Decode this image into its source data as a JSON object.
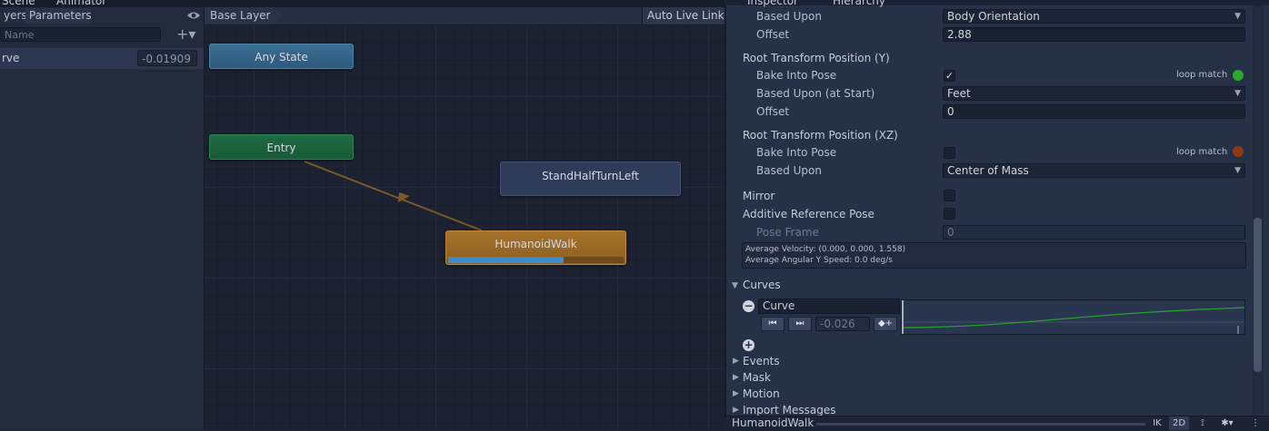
{
  "left_panel": {
    "tabs": [
      "yers",
      "Parameters"
    ],
    "search_placeholder": "Name",
    "add_label": "+▾",
    "parameter": {
      "name": "rve",
      "value": "-0.01909"
    }
  },
  "window_tabs": {
    "scene": "Scene",
    "animator": "Animator",
    "inspector": "Inspector",
    "hierarchy": "Hierarchy"
  },
  "graph": {
    "breadcrumb": "Base Layer",
    "auto_live_link": "Auto Live Link",
    "nodes": {
      "any_state": "Any State",
      "entry": "Entry",
      "stand": "StandHalfTurnLeft",
      "walk": "HumanoidWalk"
    },
    "walk_progress": 0.66,
    "colors": {
      "any": "#3a6d92",
      "entry": "#1f6b42",
      "walk": "#a6722a",
      "progress": "#3b8dd0",
      "transition": "#7a5a26"
    }
  },
  "inspector": {
    "based_upon_label": "Based Upon",
    "based_upon_value": "Body Orientation",
    "offset_label": "Offset",
    "offset_value": "2.88",
    "root_y_header": "Root Transform Position (Y)",
    "bake_label": "Bake Into Pose",
    "bake_y_checked": "✓",
    "loop_match_label": "loop match",
    "based_upon_start_label": "Based Upon (at Start)",
    "based_upon_start_value": "Feet",
    "offset_y_value": "0",
    "root_xz_header": "Root Transform Position (XZ)",
    "bake_xz_label": "Bake Into Pose",
    "loop_match_xz_label": "loop match",
    "based_upon_xz_label": "Based Upon",
    "based_upon_xz_value": "Center of Mass",
    "mirror_label": "Mirror",
    "additive_label": "Additive Reference Pose",
    "pose_frame_label": "Pose Frame",
    "pose_frame_value": "0",
    "avg_velocity": "Average Velocity: (0.000, 0.000, 1.558)",
    "avg_angular": "Average Angular Y Speed: 0.0 deg/s",
    "curves_label": "Curves",
    "curve_name": "Curve",
    "curve_value": "-0.026",
    "add_key_label": "◆+",
    "events_label": "Events",
    "mask_label": "Mask",
    "motion_label": "Motion",
    "import_label": "Import Messages",
    "loop_match_y_color": "#2ca82c",
    "loop_match_xz_color": "#8a3a12"
  },
  "preview": {
    "title": "HumanoidWalk",
    "ik": "IK",
    "twod": "2D"
  }
}
